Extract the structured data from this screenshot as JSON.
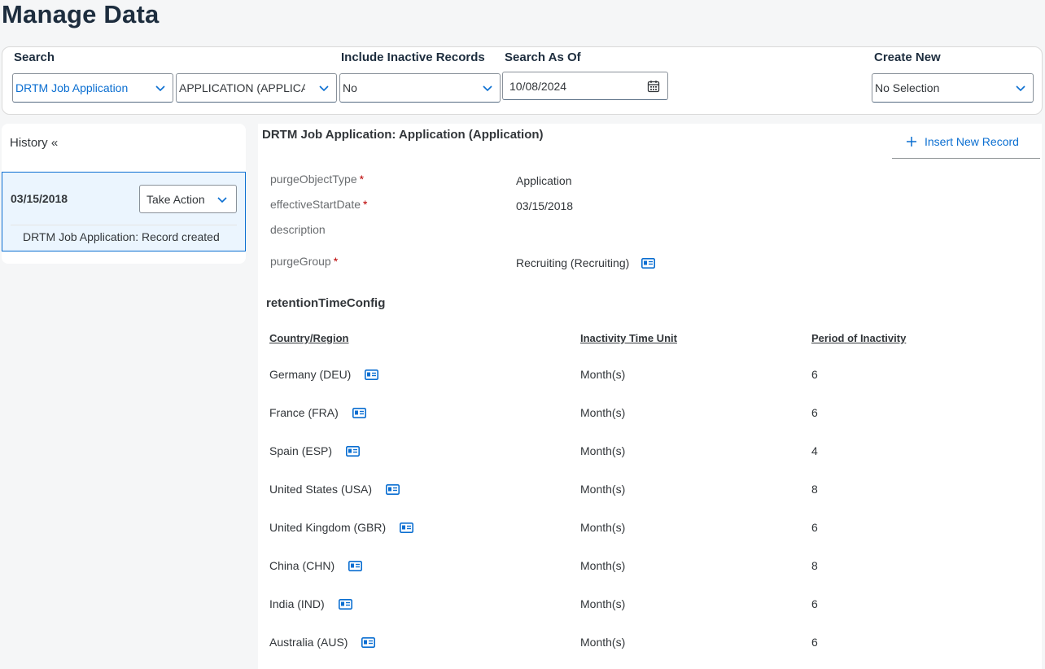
{
  "page": {
    "title": "Manage Data"
  },
  "search": {
    "label": "Search",
    "object_type": "DRTM Job Application",
    "object_instance": "APPLICATION (APPLICATION)",
    "inactive_label": "Include Inactive Records",
    "inactive_value": "No",
    "as_of_label": "Search As Of",
    "as_of_value": "10/08/2024",
    "create_label": "Create New",
    "create_value": "No Selection"
  },
  "history": {
    "title": "History «",
    "entries": [
      {
        "date": "03/15/2018",
        "action_label": "Take Action",
        "description": "DRTM Job Application: Record created"
      }
    ]
  },
  "record": {
    "title": "DRTM Job Application: Application (Application)",
    "insert_label": "Insert New Record",
    "fields": {
      "purgeObjectType": {
        "label": "purgeObjectType",
        "value": "Application"
      },
      "effectiveStartDate": {
        "label": "effectiveStartDate",
        "value": "03/15/2018"
      },
      "description": {
        "label": "description",
        "value": ""
      },
      "purgeGroup": {
        "label": "purgeGroup",
        "value": "Recruiting (Recruiting)"
      }
    },
    "required_marker": "*"
  },
  "retention": {
    "title": "retentionTimeConfig",
    "columns": [
      "Country/Region",
      "Inactivity Time Unit",
      "Period of Inactivity"
    ],
    "rows": [
      {
        "country": "Germany (DEU)",
        "unit": "Month(s)",
        "period": "6"
      },
      {
        "country": "France (FRA)",
        "unit": "Month(s)",
        "period": "6"
      },
      {
        "country": "Spain (ESP)",
        "unit": "Month(s)",
        "period": "4"
      },
      {
        "country": "United States (USA)",
        "unit": "Month(s)",
        "period": "8"
      },
      {
        "country": "United Kingdom (GBR)",
        "unit": "Month(s)",
        "period": "6"
      },
      {
        "country": "China (CHN)",
        "unit": "Month(s)",
        "period": "8"
      },
      {
        "country": "India (IND)",
        "unit": "Month(s)",
        "period": "6"
      },
      {
        "country": "Australia (AUS)",
        "unit": "Month(s)",
        "period": "6"
      }
    ]
  },
  "icons": {
    "chevron": "chevron-down-icon",
    "calendar": "calendar-icon",
    "plus": "plus-icon",
    "details": "contact-card-icon"
  },
  "colors": {
    "accent": "#0a6ed1",
    "required": "#bb0000",
    "title": "#1d2d3e"
  }
}
